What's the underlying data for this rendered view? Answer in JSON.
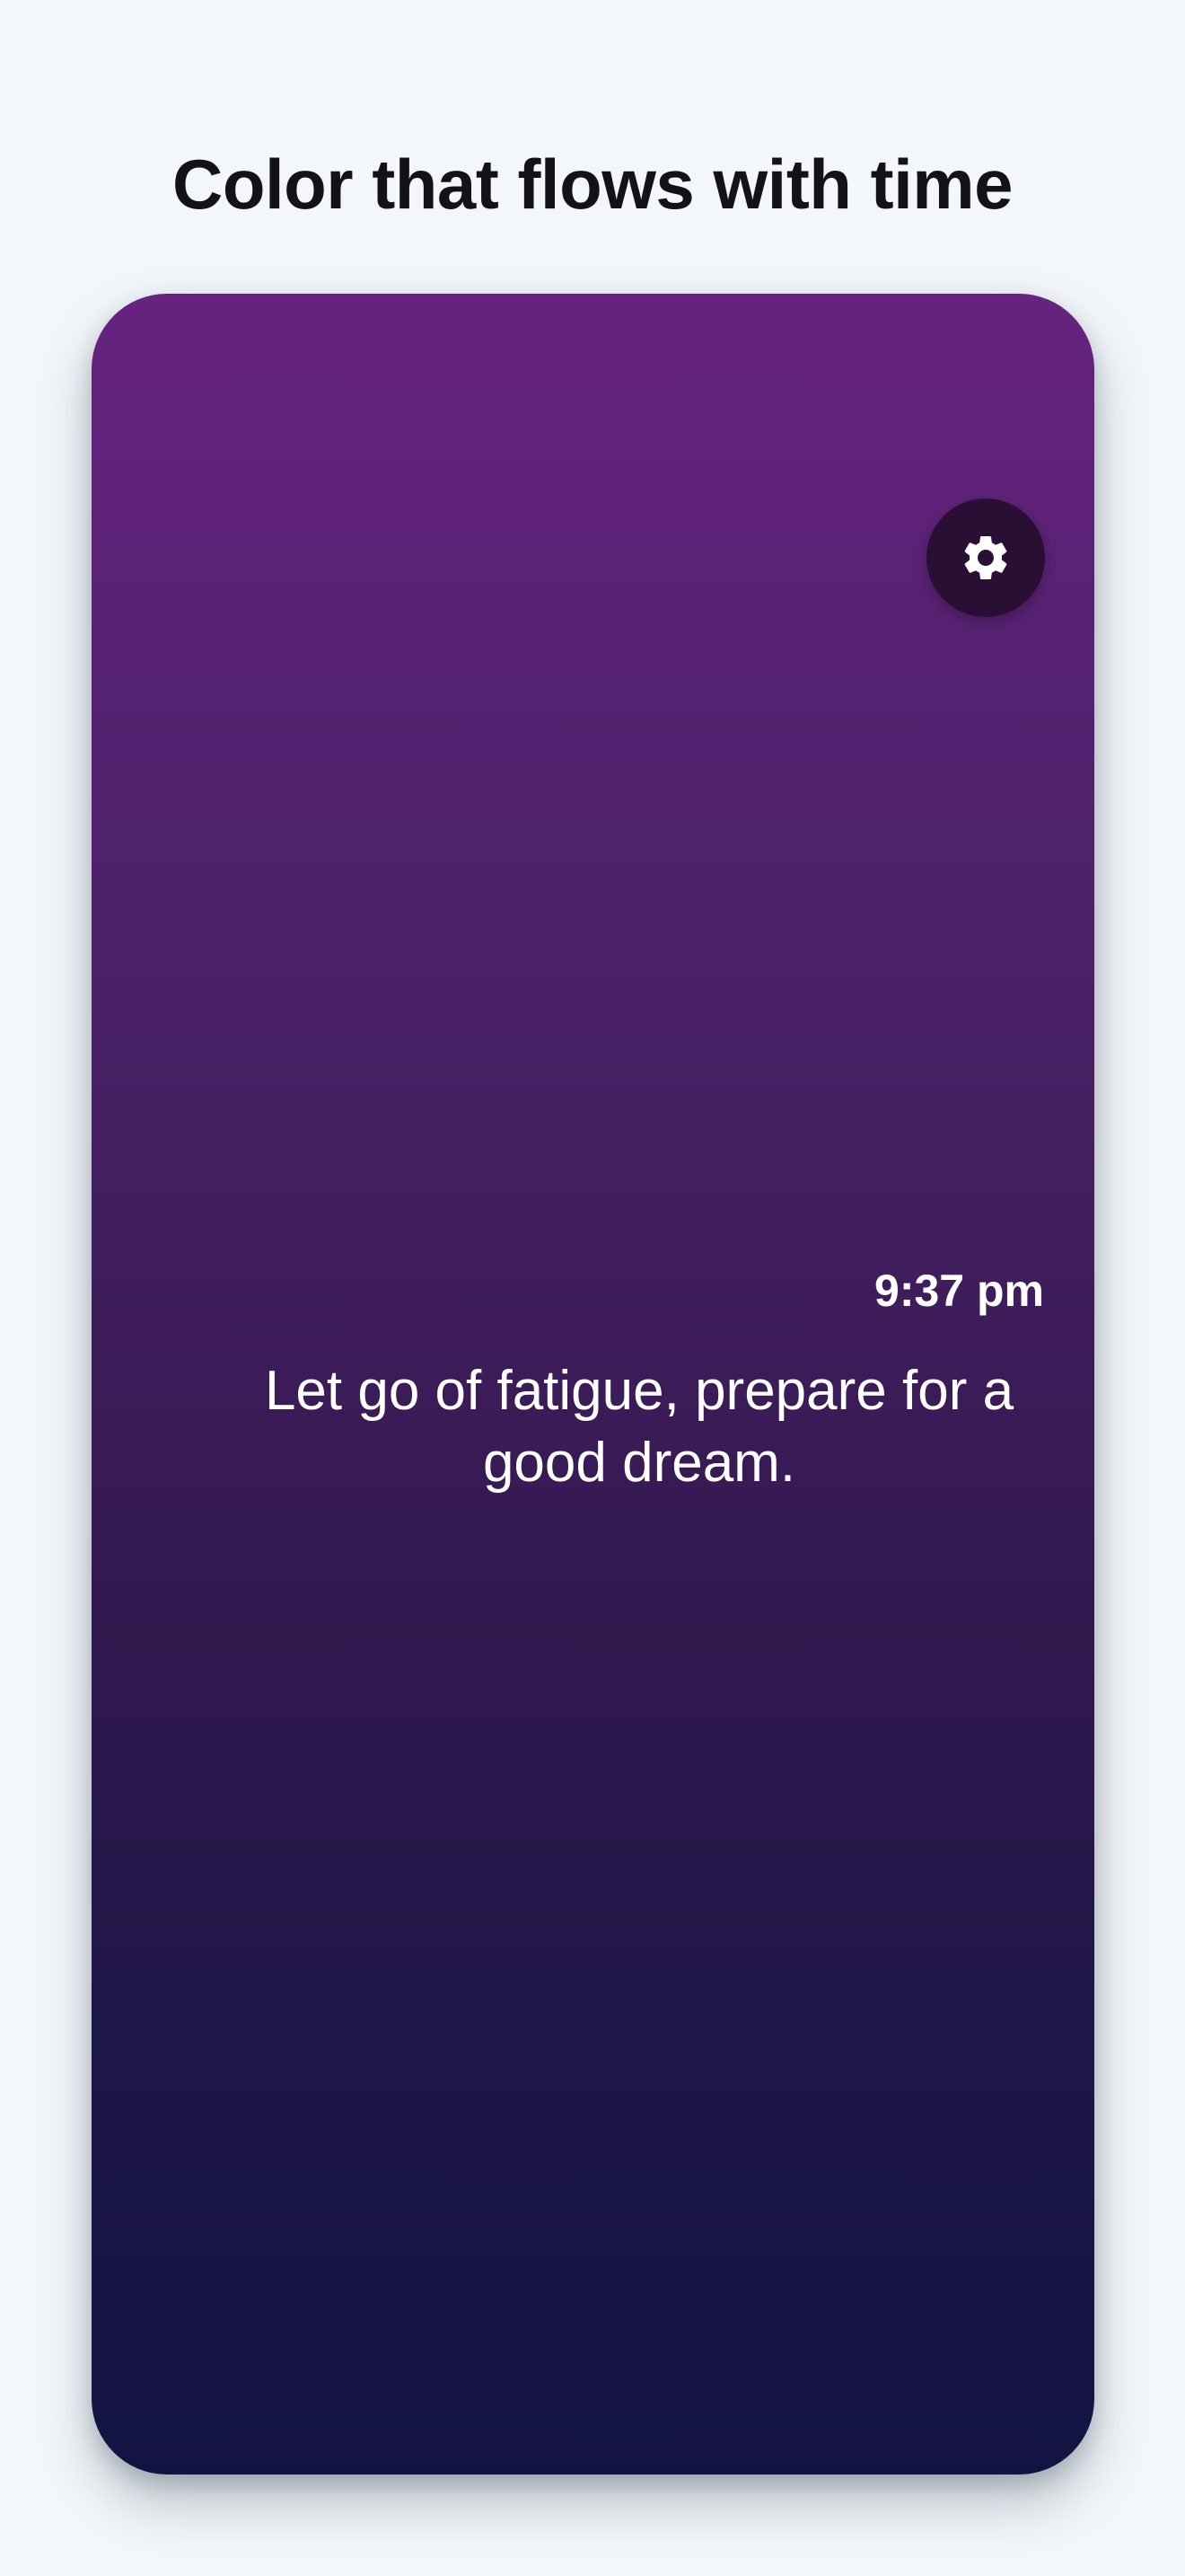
{
  "page": {
    "headline": "Color that flows with time"
  },
  "card": {
    "gradient_colors": [
      "#66237f",
      "#4c2169",
      "#33194f",
      "#1e1747",
      "#131341"
    ],
    "settings_icon": "gear-icon",
    "settings_button_color": "#2a0f34",
    "time": "9:37 pm",
    "message": "Let go of fatigue, prepare for a good dream."
  }
}
